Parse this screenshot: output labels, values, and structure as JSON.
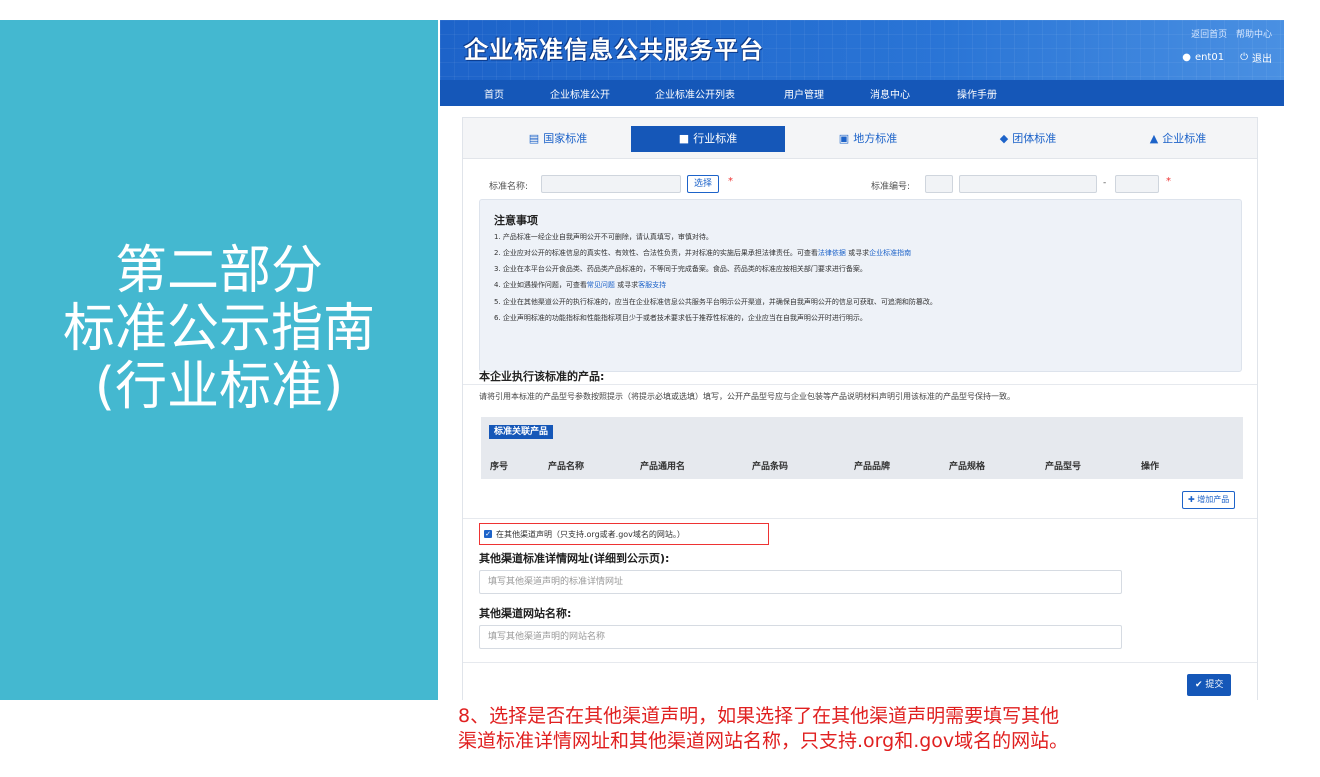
{
  "slide": {
    "title_line1": "第二部分",
    "title_line2": "标准公示指南",
    "title_line3": "(行业标准)",
    "caption_line1": "8、选择是否在其他渠道声明，如果选择了在其他渠道声明需要填写其他",
    "caption_line2": "渠道标准详情网址和其他渠道网站名称，只支持.org和.gov域名的网站。"
  },
  "header": {
    "logo": "企业标准信息公共服务平台",
    "link_home": "返回首页",
    "link_help": "帮助中心",
    "user": "ent01",
    "logout": "退出"
  },
  "nav": [
    "首页",
    "企业标准公开",
    "企业标准公开列表",
    "用户管理",
    "消息中心",
    "操作手册"
  ],
  "tabs": [
    "国家标准",
    "行业标准",
    "地方标准",
    "团体标准",
    "企业标准"
  ],
  "form": {
    "std_name_label": "标准名称:",
    "select_btn": "选择",
    "required_mark": "*",
    "std_no_label": "标准编号:",
    "dash": "-"
  },
  "notes": {
    "title": "注意事项",
    "l1": "1. 产品标准一经企业自我声明公开不可删除，请认真填写，审慎对待。",
    "l2a": "2. 企业应对公开的标准信息的真实性、有效性、合法性负责，并对标准的实施后果承担法律责任。可查看",
    "l2_link1": "法律依据",
    "l2b": " 或寻求",
    "l2_link2": "企业标准指南",
    "l3": "3. 企业在本平台公开食品类、药品类产品标准的，不等同于完成备案。食品、药品类的标准应按相关部门要求进行备案。",
    "l4a": "4. 企业如遇操作问题，可查看",
    "l4_link1": "常见问题",
    "l4b": " 或寻求",
    "l4_link2": "客服支持",
    "l5": "5. 企业在其他渠道公开的执行标准的，应当在企业标准信息公共服务平台明示公开渠道，并确保自我声明公开的信息可获取、可追溯和防篡改。",
    "l6": "6. 企业声明标准的功能指标和性能指标项目少于或者技术要求低于推荐性标准的，企业应当在自我声明公开时进行明示。"
  },
  "products": {
    "title": "本企业执行该标准的产品:",
    "desc": "请将引用本标准的产品型号参数按照提示（将提示必填或选填）填写，公开产品型号应与企业包装等产品说明材料声明引用该标准的产品型号保持一致。",
    "badge": "标准关联产品",
    "columns": [
      "序号",
      "产品名称",
      "产品通用名",
      "产品条码",
      "产品品牌",
      "产品规格",
      "产品型号",
      "操作"
    ],
    "add_btn": "增加产品"
  },
  "other_channel": {
    "checkbox_label": "在其他渠道声明（只支持.org或者.gov域名的网站。）",
    "url_label": "其他渠道标准详情网址(详细到公示页):",
    "url_placeholder": "填写其他渠道声明的标准详情网址",
    "site_label": "其他渠道网站名称:",
    "site_placeholder": "填写其他渠道声明的网站名称",
    "submit": "提交"
  }
}
